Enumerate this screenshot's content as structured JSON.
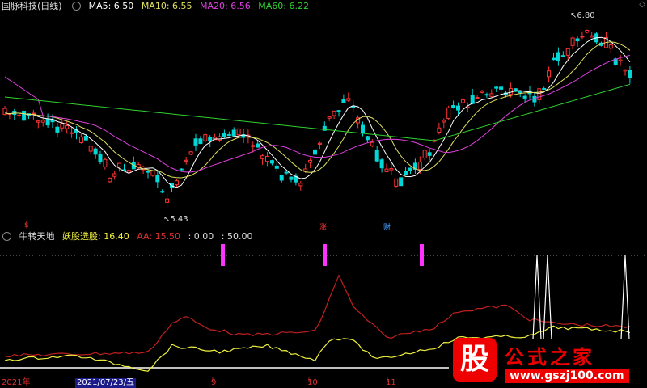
{
  "main_header": {
    "title": "国脉科技(日线)",
    "ma5": "MA5: 6.50",
    "ma10": "MA10: 6.55",
    "ma20": "MA20: 6.56",
    "ma60": "MA60: 6.22"
  },
  "indicator_header": {
    "name": "牛转天地",
    "v1": "妖股选股: 16.40",
    "v2": "AA: 15.50",
    "v3": ": 0.00",
    "v4": ": 50.00"
  },
  "annotations": {
    "high": "↖6.80",
    "low": "↖5.43",
    "mark_1": "$",
    "mark_2": "涨",
    "mark_3": "财"
  },
  "x_axis": {
    "labels": [
      "2021年",
      "2021/07/23/五",
      "9",
      "10",
      "11"
    ]
  },
  "logo": {
    "gu": "股",
    "title": "公式之家",
    "url": "www.gszj100.com"
  },
  "colors": {
    "up": "#ff3333",
    "down": "#00d8d8",
    "ma5": "#ffffff",
    "ma10": "#e0e060",
    "ma20": "#e040e0",
    "ma60": "#30d030",
    "aa_line": "#c02020",
    "yao_line": "#f0f040",
    "signal": "#ff33ff"
  }
}
